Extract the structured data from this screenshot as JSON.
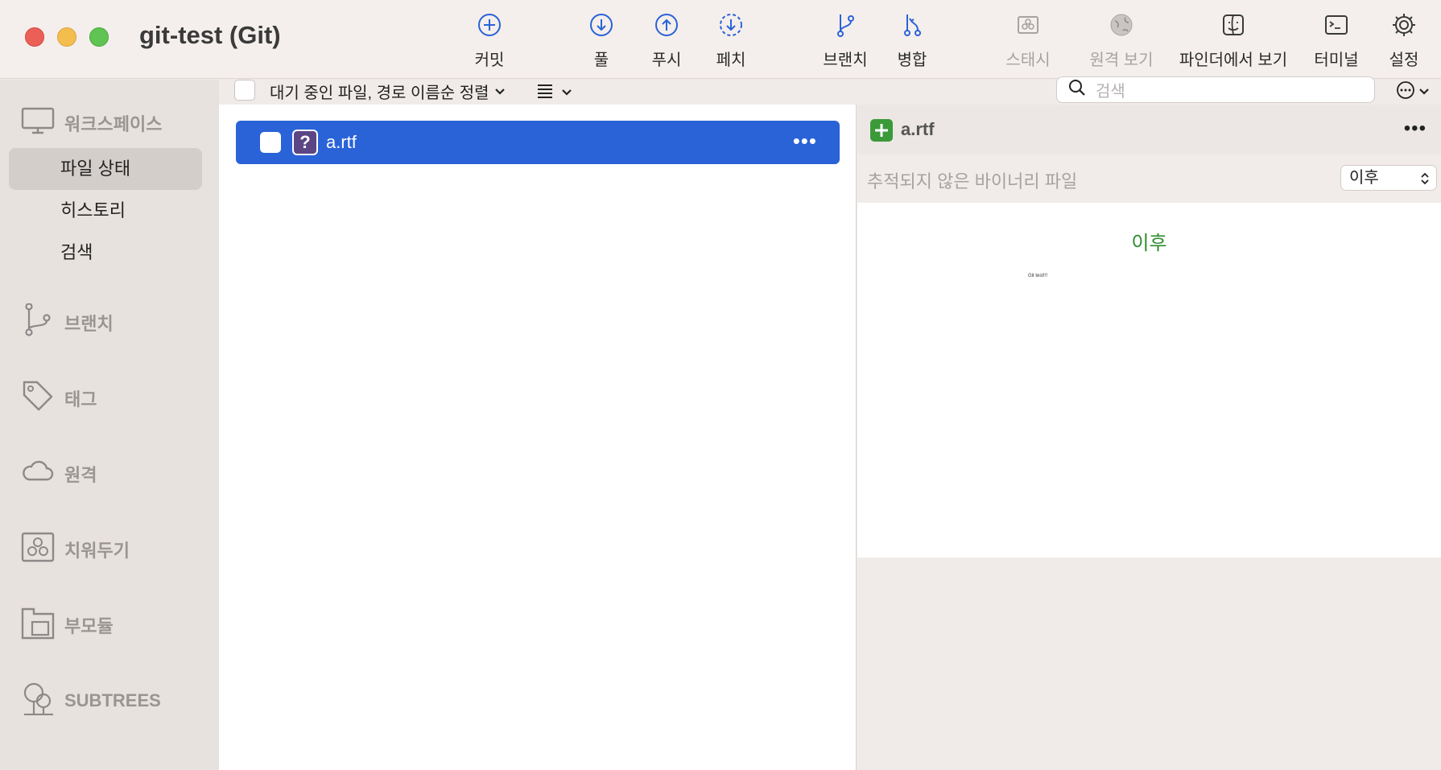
{
  "window": {
    "title": "git-test (Git)"
  },
  "toolbar": {
    "commit": "커밋",
    "pull": "풀",
    "push": "푸시",
    "fetch": "페치",
    "branch": "브랜치",
    "merge": "병합",
    "stash": "스태시",
    "remote_view": "원격 보기",
    "finder_view": "파인더에서 보기",
    "terminal": "터미널",
    "settings": "설정"
  },
  "sidebar": {
    "workspace": "워크스페이스",
    "file_status": "파일 상태",
    "history": "히스토리",
    "search": "검색",
    "branches": "브랜치",
    "tags": "태그",
    "remotes": "원격",
    "stashes": "치워두기",
    "submodules": "부모듈",
    "subtrees": "SUBTREES"
  },
  "filebar": {
    "sort_label": "대기 중인 파일, 경로 이름순 정렬",
    "search_placeholder": "검색"
  },
  "files": [
    {
      "name": "a.rtf",
      "status": "?"
    }
  ],
  "preview": {
    "filename": "a.rtf",
    "subtitle": "추적되지 않은 바이너리 파일",
    "select_value": "이후",
    "heading": "이후",
    "thumbnail_text": "Git test!!!"
  },
  "colors": {
    "accent": "#2a62d8",
    "added": "#2e8b2e",
    "unknown_badge": "#5b4585"
  }
}
